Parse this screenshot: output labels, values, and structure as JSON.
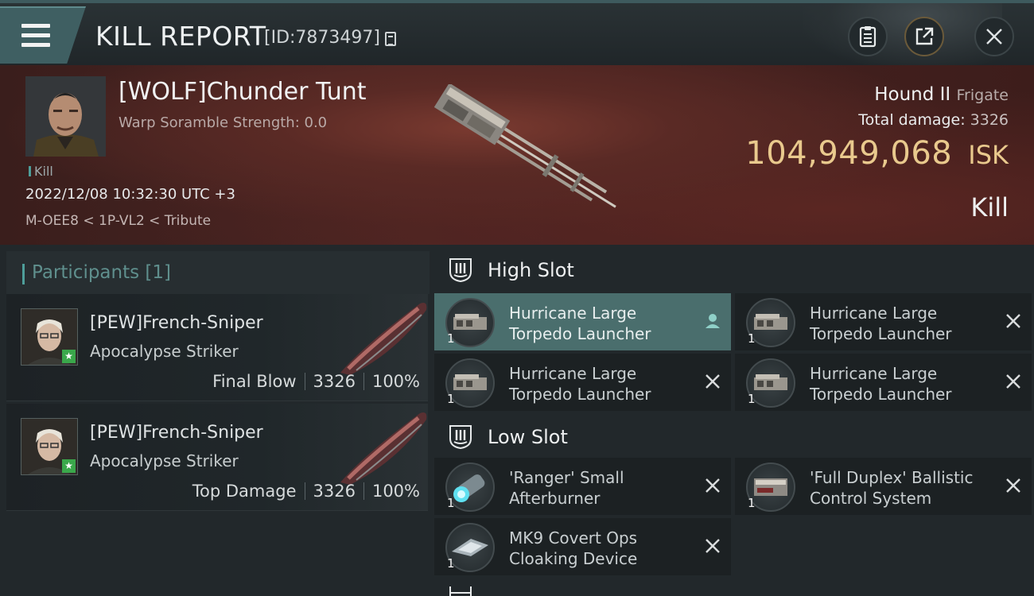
{
  "header": {
    "title": "KILL REPORT",
    "report_id": "[ID:7873497]"
  },
  "victim": {
    "name": "[WOLF]Chunder Tunt",
    "scramble": "Warp Soramble Strength: 0.0",
    "tag": "Kill",
    "datetime": "2022/12/08 10:32:30 UTC +3",
    "location": "M-OEE8 < 1P-VL2 < Tribute",
    "ship": "Hound II",
    "ship_class": "Frigate",
    "total_damage_label": "Total damage:",
    "total_damage": "3326",
    "isk_value": "104,949,068",
    "isk_unit": "ISK",
    "result": "Kill"
  },
  "participants": {
    "header": "Participants [1]",
    "items": [
      {
        "name": "[PEW]French-Sniper",
        "ship": "Apocalypse Striker",
        "role": "Final Blow",
        "damage": "3326",
        "percent": "100%"
      },
      {
        "name": "[PEW]French-Sniper",
        "ship": "Apocalypse Striker",
        "role": "Top Damage",
        "damage": "3326",
        "percent": "100%"
      }
    ]
  },
  "fitting": {
    "high_slot": {
      "label": "High Slot",
      "modules": [
        {
          "name_line1": "Hurricane Large",
          "name_line2": "Torpedo Launcher",
          "qty": "1"
        },
        {
          "name_line1": "Hurricane Large",
          "name_line2": "Torpedo Launcher",
          "qty": "1"
        },
        {
          "name_line1": "Hurricane Large",
          "name_line2": "Torpedo Launcher",
          "qty": "1"
        },
        {
          "name_line1": "Hurricane Large",
          "name_line2": "Torpedo Launcher",
          "qty": "1"
        }
      ]
    },
    "low_slot": {
      "label": "Low Slot",
      "modules": [
        {
          "name_line1": "'Ranger' Small",
          "name_line2": "Afterburner",
          "qty": "1"
        },
        {
          "name_line1": "'Full Duplex' Ballistic",
          "name_line2": "Control System",
          "qty": "1"
        },
        {
          "name_line1": "MK9 Covert Ops",
          "name_line2": "Cloaking Device",
          "qty": "1"
        }
      ]
    }
  },
  "colors": {
    "accent": "#4e9e9a",
    "isk": "#e9c98d",
    "selected": "#4a6e6d",
    "badge": "#3aa84b"
  },
  "icons": [
    "menu-icon",
    "copy-icon",
    "clipboard-icon",
    "share-icon",
    "close-icon",
    "slot-icon",
    "dropped-icon",
    "destroyed-icon"
  ]
}
